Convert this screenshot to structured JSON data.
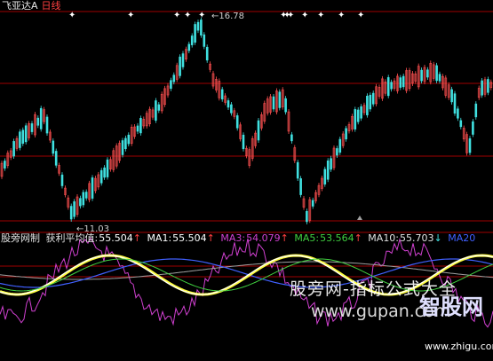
{
  "header": {
    "symbol": "飞亚达A",
    "period": "日线"
  },
  "price_chart": {
    "high_label": "16.78",
    "low_label": "11.03"
  },
  "indicator": {
    "name": "股旁网制",
    "avg_label": "获利平均值:",
    "avg_value": "55.504",
    "ma1_label": "MA1:",
    "ma1_value": "55.504",
    "ma3_label": "MA3:",
    "ma3_value": "54.079",
    "ma5_label": "MA5:",
    "ma5_value": "53.564",
    "ma10_label": "MA10:",
    "ma10_value": "55.703",
    "ma20_label": "MA20",
    "arrow_up": "↑",
    "arrow_down": "↓"
  },
  "watermark": {
    "line1": "股旁网-指标公式大全",
    "line2": "www.gupan.com",
    "logo": "智股网",
    "logo_url": "www.zhigu.com"
  },
  "colors": {
    "background": "#000000",
    "grid_red": "#a00000",
    "candle_up": "#ff5050",
    "candle_down": "#40e0e0",
    "ma1": "#ffffff",
    "ma3": "#d040d0",
    "ma5": "#40d040",
    "ma10": "#e0e0e0",
    "ma20": "#4060ff",
    "yellow": "#ffff40"
  }
}
